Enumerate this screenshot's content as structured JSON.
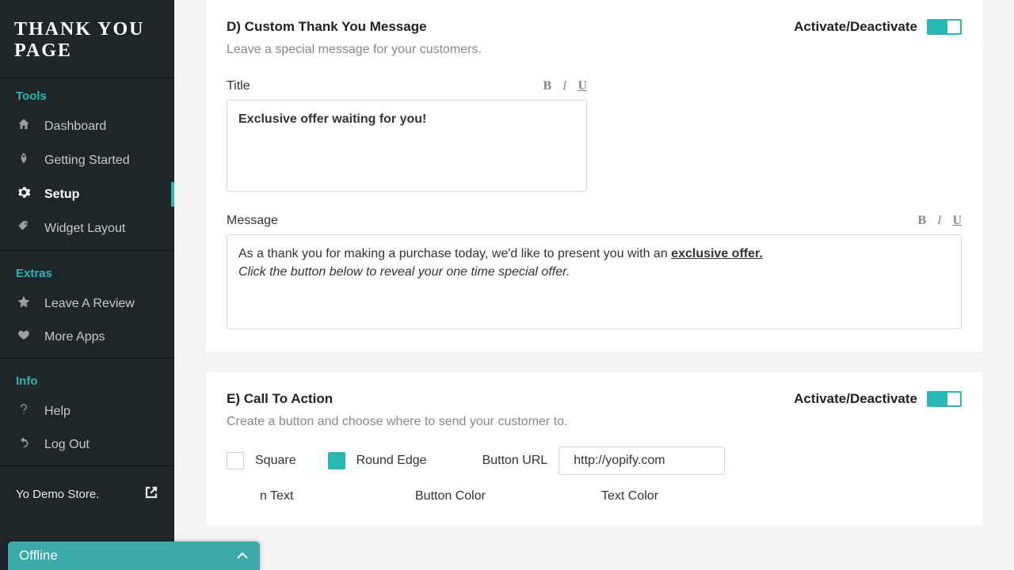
{
  "logo": "THANK YOU PAGE",
  "sections": {
    "tools": {
      "label": "Tools",
      "items": [
        {
          "icon": "home",
          "label": "Dashboard"
        },
        {
          "icon": "rocket",
          "label": "Getting Started"
        },
        {
          "icon": "gear",
          "label": "Setup",
          "active": true
        },
        {
          "icon": "tag",
          "label": "Widget Layout"
        }
      ]
    },
    "extras": {
      "label": "Extras",
      "items": [
        {
          "icon": "star",
          "label": "Leave A Review"
        },
        {
          "icon": "heart",
          "label": "More Apps"
        }
      ]
    },
    "info": {
      "label": "Info",
      "items": [
        {
          "icon": "question",
          "label": "Help"
        },
        {
          "icon": "undo",
          "label": "Log Out"
        }
      ]
    }
  },
  "store": "Yo Demo Store.",
  "offline": "Offline",
  "cards": {
    "d": {
      "title": "D) Custom Thank You Message",
      "sub": "Leave a special message for your customers.",
      "toggle_label": "Activate/Deactivate",
      "title_label": "Title",
      "title_value": "Exclusive offer waiting for you!",
      "message_label": "Message",
      "message_prefix": "As a thank you for making a purchase today, we'd like to present you with an ",
      "message_underlined": "exclusive offer.",
      "message_line2": "Click the button below to reveal your one time special offer.",
      "fmt_b": "B",
      "fmt_i": "I",
      "fmt_u": "U"
    },
    "e": {
      "title": "E) Call To Action",
      "sub": "Create a button and choose where to send your customer to.",
      "toggle_label": "Activate/Deactivate",
      "square": "Square",
      "round": "Round Edge",
      "url_label": "Button URL",
      "url_value": "http://yopify.com",
      "btn_text": "n Text",
      "btn_color": "Button Color",
      "text_color": "Text Color"
    }
  }
}
